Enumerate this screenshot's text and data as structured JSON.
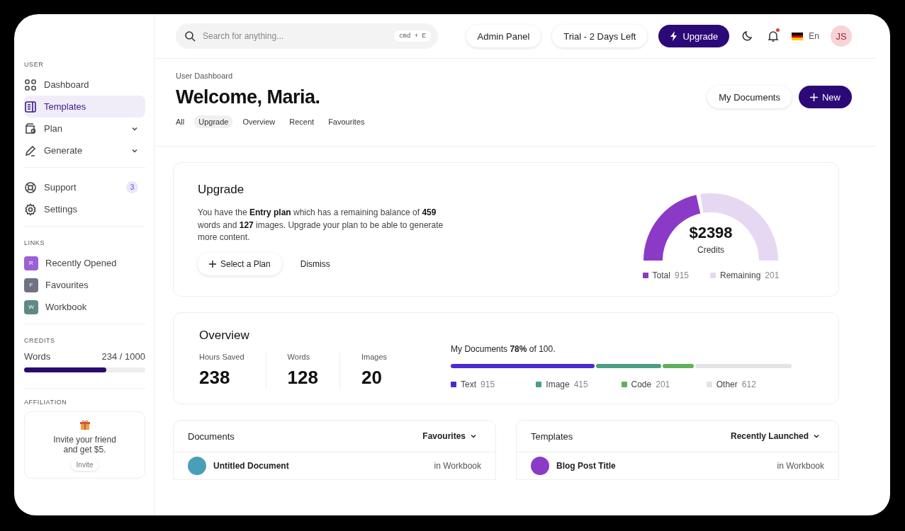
{
  "sidebar": {
    "sections": [
      {
        "heading": "USER",
        "items": [
          {
            "kind": "grid",
            "label": "Dashboard",
            "selected": false
          },
          {
            "kind": "doc",
            "label": "Templates",
            "selected": true
          },
          {
            "kind": "wallet",
            "label": "Plan",
            "selected": false,
            "expandable": true
          },
          {
            "kind": "pen",
            "label": "Generate",
            "selected": false,
            "expandable": true
          }
        ]
      },
      {
        "items": [
          {
            "kind": "lifebuoy",
            "label": "Support",
            "selected": false,
            "badge": "3"
          },
          {
            "kind": "gear",
            "label": "Settings",
            "selected": false
          }
        ]
      }
    ],
    "links": {
      "heading": "LINKS",
      "items": [
        {
          "letter": "R",
          "label": "Recently Opened",
          "color": "#9b5fd6"
        },
        {
          "letter": "F",
          "label": "Favourites",
          "color": "#6f7282"
        },
        {
          "letter": "W",
          "label": "Workbook",
          "color": "#5f8985"
        }
      ]
    },
    "credits": {
      "heading": "CREDITS",
      "label": "Words",
      "reading": "234 / 1000",
      "level": 0.68
    },
    "affiliation": {
      "heading": "AFFILIATION",
      "text": "Invite your friend and get $5.",
      "button": "Invite"
    }
  },
  "topbar": {
    "search": {
      "placeholder": "Search for anything...",
      "shortcut": "cmd + E"
    },
    "admin": "Admin Panel",
    "trial": "Trial - 2 Days Left",
    "upgrade": "Upgrade",
    "notification": true,
    "language": "En",
    "avatar": "JS"
  },
  "header": {
    "breadcrumb": "User Dashboard",
    "title": "Welcome, Maria.",
    "secondary_button": "My Documents",
    "primary_button": "New",
    "tabs": [
      {
        "label": "All",
        "selected": false
      },
      {
        "label": "Upgrade",
        "selected": true
      },
      {
        "label": "Overview",
        "selected": false
      },
      {
        "label": "Recent",
        "selected": false
      },
      {
        "label": "Favourites",
        "selected": false
      }
    ]
  },
  "upgrade_card": {
    "title": "Upgrade",
    "text": "You have the **Entry plan** which has a remaining balance of **459** words and **127** images. Upgrade your plan to be able to generate more content.",
    "select_button": "Select a Plan",
    "dismiss_button": "Dismiss",
    "gauge": {
      "amount": "$2398",
      "caption": "Credits",
      "level": 0.44,
      "legend": [
        {
          "label": "Total",
          "value": "915",
          "color": "#8b3ac8"
        },
        {
          "label": "Remaining",
          "value": "201",
          "color": "#e6d8f2"
        }
      ]
    }
  },
  "overview": {
    "title": "Overview",
    "stats": [
      {
        "label": "Hours Saved",
        "value": "238"
      },
      {
        "label": "Words",
        "value": "128"
      },
      {
        "label": "Images",
        "value": "20"
      }
    ],
    "usage_text": "My Documents **78%** of 100.",
    "segments": [
      {
        "label": "Text",
        "value": "915",
        "color": "#4b2bd0"
      },
      {
        "label": "Image",
        "value": "415",
        "color": "#4a9e84"
      },
      {
        "label": "Code",
        "value": "201",
        "color": "#5cb35c"
      },
      {
        "label": "Other",
        "value": "612",
        "color": "#e4e4e4"
      }
    ]
  },
  "panels": [
    {
      "title": "Documents",
      "filter": "Favourites",
      "rows": [
        {
          "name": "Untitled Document",
          "location": "in Workbook",
          "color": "#4a9fb8"
        }
      ]
    },
    {
      "title": "Templates",
      "filter": "Recently Launched",
      "rows": [
        {
          "name": "Blog Post Title",
          "location": "in Workbook",
          "color": "#8b3ac8"
        }
      ]
    }
  ]
}
